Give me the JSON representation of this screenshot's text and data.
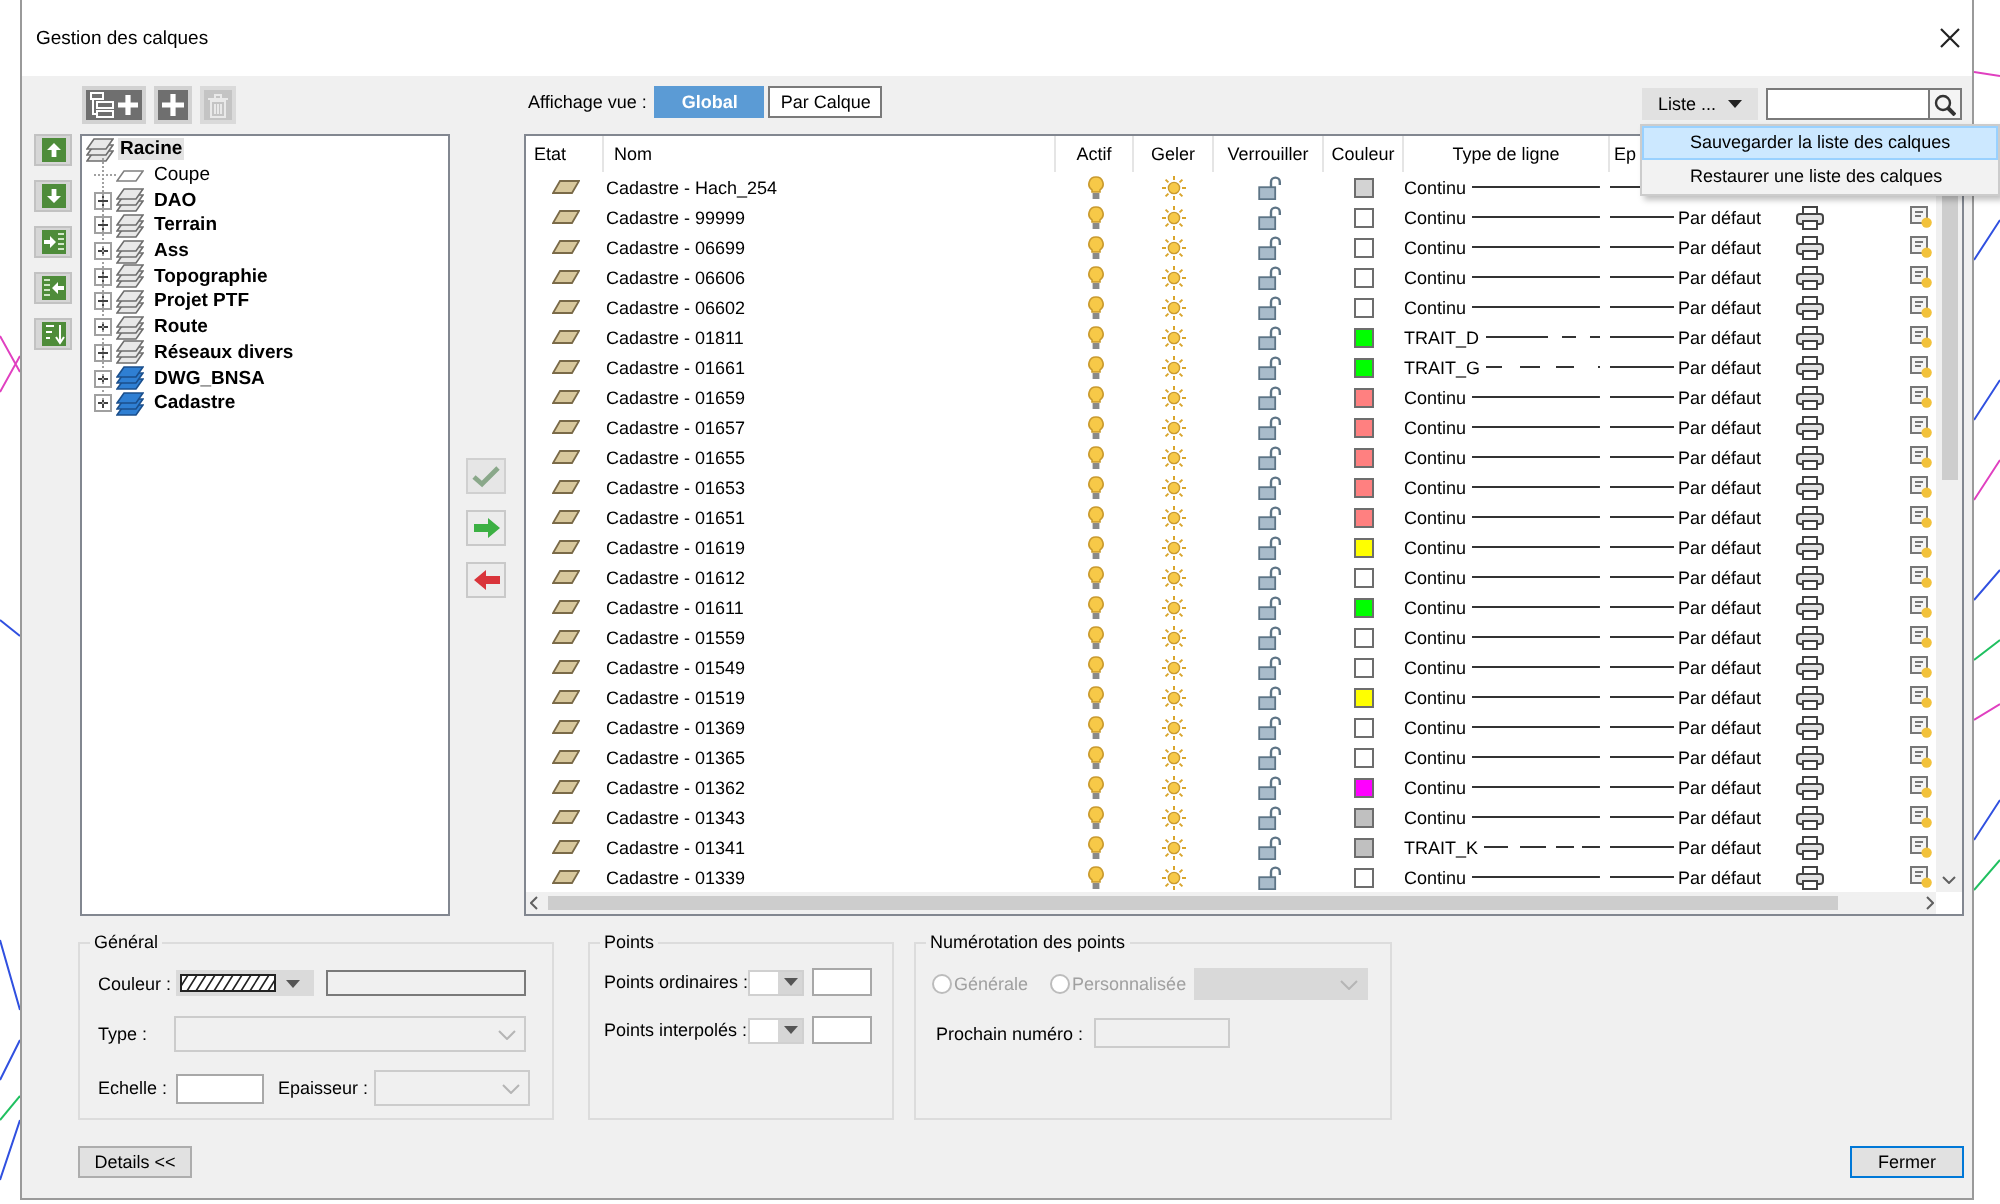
{
  "window": {
    "title": "Gestion des calques"
  },
  "toolbar": [
    {
      "kind": "add_group",
      "disabled": false
    },
    {
      "kind": "add_layer",
      "disabled": false
    },
    {
      "kind": "delete",
      "disabled": true
    }
  ],
  "side_buttons": [
    {
      "kind": "up"
    },
    {
      "kind": "down"
    },
    {
      "kind": "import"
    },
    {
      "kind": "export"
    },
    {
      "kind": "sort"
    }
  ],
  "tree": {
    "items": [
      {
        "label": "Racine",
        "kind": "root",
        "selected": true,
        "children": [
          {
            "label": "Coupe",
            "kind": "layer",
            "selected": false
          },
          {
            "label": "DAO",
            "kind": "group",
            "expanded": false,
            "selected": false
          },
          {
            "label": "Terrain",
            "kind": "group",
            "expanded": false,
            "selected": false
          },
          {
            "label": "Ass",
            "kind": "group",
            "expanded": false,
            "selected": false
          },
          {
            "label": "Topographie",
            "kind": "group",
            "expanded": false,
            "selected": false
          },
          {
            "label": "Projet PTF",
            "kind": "group",
            "expanded": false,
            "selected": false
          },
          {
            "label": "Route",
            "kind": "group",
            "expanded": false,
            "selected": false
          },
          {
            "label": "Réseaux divers",
            "kind": "group",
            "expanded": false,
            "selected": false
          },
          {
            "label": "DWG_BNSA",
            "kind": "xref",
            "expanded": false,
            "selected": false
          },
          {
            "label": "Cadastre",
            "kind": "xref",
            "expanded": false,
            "selected": false
          }
        ]
      }
    ]
  },
  "transfer_buttons": [
    {
      "kind": "apply",
      "disabled": true
    },
    {
      "kind": "add",
      "disabled": false
    },
    {
      "kind": "remove",
      "disabled": false
    }
  ],
  "view": {
    "label": "Affichage vue :",
    "options": [
      {
        "label": "Global",
        "selected": true
      },
      {
        "label": "Par Calque",
        "selected": false
      }
    ]
  },
  "list_button": {
    "label": "Liste ..."
  },
  "list_menu": {
    "items": [
      {
        "label": "Sauvegarder la liste des calques",
        "selected": true
      },
      {
        "label": "Restaurer une liste des calques",
        "selected": false
      }
    ]
  },
  "table": {
    "columns": [
      "Etat",
      "Nom",
      "Actif",
      "Geler",
      "Verrouiller",
      "Couleur",
      "Type de ligne",
      "Ep"
    ],
    "rows": [
      {
        "name": "Cadastre - Hach_254",
        "active": true,
        "frozen": false,
        "locked": false,
        "color": "#d3d3d3",
        "linetype": {
          "name": "Continu",
          "kind": "solid"
        }
      },
      {
        "name": "Cadastre - 99999",
        "active": true,
        "frozen": false,
        "locked": false,
        "color": "#ffffff",
        "linetype": {
          "name": "Continu",
          "kind": "solid"
        },
        "weight": "Par défaut",
        "plot": true
      },
      {
        "name": "Cadastre - 06699",
        "active": true,
        "frozen": false,
        "locked": false,
        "color": "#ffffff",
        "linetype": {
          "name": "Continu",
          "kind": "solid"
        },
        "weight": "Par défaut",
        "plot": true
      },
      {
        "name": "Cadastre - 06606",
        "active": true,
        "frozen": false,
        "locked": false,
        "color": "#ffffff",
        "linetype": {
          "name": "Continu",
          "kind": "solid"
        },
        "weight": "Par défaut",
        "plot": true
      },
      {
        "name": "Cadastre - 06602",
        "active": true,
        "frozen": false,
        "locked": false,
        "color": "#ffffff",
        "linetype": {
          "name": "Continu",
          "kind": "solid"
        },
        "weight": "Par défaut",
        "plot": true
      },
      {
        "name": "Cadastre - 01811",
        "active": true,
        "frozen": false,
        "locked": false,
        "color": "#00ff00",
        "linetype": {
          "name": "TRAIT_D",
          "kind": "longshort"
        },
        "weight": "Par défaut",
        "plot": true
      },
      {
        "name": "Cadastre - 01661",
        "active": true,
        "frozen": false,
        "locked": false,
        "color": "#00ff00",
        "linetype": {
          "name": "TRAIT_G",
          "kind": "dashdot"
        },
        "weight": "Par défaut",
        "plot": true
      },
      {
        "name": "Cadastre - 01659",
        "active": true,
        "frozen": false,
        "locked": false,
        "color": "#ff8080",
        "linetype": {
          "name": "Continu",
          "kind": "solid"
        },
        "weight": "Par défaut",
        "plot": true
      },
      {
        "name": "Cadastre - 01657",
        "active": true,
        "frozen": false,
        "locked": false,
        "color": "#ff8080",
        "linetype": {
          "name": "Continu",
          "kind": "solid"
        },
        "weight": "Par défaut",
        "plot": true
      },
      {
        "name": "Cadastre - 01655",
        "active": true,
        "frozen": false,
        "locked": false,
        "color": "#ff8080",
        "linetype": {
          "name": "Continu",
          "kind": "solid"
        },
        "weight": "Par défaut",
        "plot": true
      },
      {
        "name": "Cadastre - 01653",
        "active": true,
        "frozen": false,
        "locked": false,
        "color": "#ff8080",
        "linetype": {
          "name": "Continu",
          "kind": "solid"
        },
        "weight": "Par défaut",
        "plot": true
      },
      {
        "name": "Cadastre - 01651",
        "active": true,
        "frozen": false,
        "locked": false,
        "color": "#ff8080",
        "linetype": {
          "name": "Continu",
          "kind": "solid"
        },
        "weight": "Par défaut",
        "plot": true
      },
      {
        "name": "Cadastre - 01619",
        "active": true,
        "frozen": false,
        "locked": false,
        "color": "#ffff00",
        "linetype": {
          "name": "Continu",
          "kind": "solid"
        },
        "weight": "Par défaut",
        "plot": true
      },
      {
        "name": "Cadastre - 01612",
        "active": true,
        "frozen": false,
        "locked": false,
        "color": "#ffffff",
        "linetype": {
          "name": "Continu",
          "kind": "solid"
        },
        "weight": "Par défaut",
        "plot": true
      },
      {
        "name": "Cadastre - 01611",
        "active": true,
        "frozen": false,
        "locked": false,
        "color": "#00ff00",
        "linetype": {
          "name": "Continu",
          "kind": "solid"
        },
        "weight": "Par défaut",
        "plot": true
      },
      {
        "name": "Cadastre - 01559",
        "active": true,
        "frozen": false,
        "locked": false,
        "color": "#ffffff",
        "linetype": {
          "name": "Continu",
          "kind": "solid"
        },
        "weight": "Par défaut",
        "plot": true
      },
      {
        "name": "Cadastre - 01549",
        "active": true,
        "frozen": false,
        "locked": false,
        "color": "#ffffff",
        "linetype": {
          "name": "Continu",
          "kind": "solid"
        },
        "weight": "Par défaut",
        "plot": true
      },
      {
        "name": "Cadastre - 01519",
        "active": true,
        "frozen": false,
        "locked": false,
        "color": "#ffff00",
        "linetype": {
          "name": "Continu",
          "kind": "solid"
        },
        "weight": "Par défaut",
        "plot": true
      },
      {
        "name": "Cadastre - 01369",
        "active": true,
        "frozen": false,
        "locked": false,
        "color": "#ffffff",
        "linetype": {
          "name": "Continu",
          "kind": "solid"
        },
        "weight": "Par défaut",
        "plot": true
      },
      {
        "name": "Cadastre - 01365",
        "active": true,
        "frozen": false,
        "locked": false,
        "color": "#ffffff",
        "linetype": {
          "name": "Continu",
          "kind": "solid"
        },
        "weight": "Par défaut",
        "plot": true
      },
      {
        "name": "Cadastre - 01362",
        "active": true,
        "frozen": false,
        "locked": false,
        "color": "#ff00ff",
        "linetype": {
          "name": "Continu",
          "kind": "solid"
        },
        "weight": "Par défaut",
        "plot": true
      },
      {
        "name": "Cadastre - 01343",
        "active": true,
        "frozen": false,
        "locked": false,
        "color": "#c0c0c0",
        "linetype": {
          "name": "Continu",
          "kind": "solid"
        },
        "weight": "Par défaut",
        "plot": true
      },
      {
        "name": "Cadastre - 01341",
        "active": true,
        "frozen": false,
        "locked": false,
        "color": "#c0c0c0",
        "linetype": {
          "name": "TRAIT_K",
          "kind": "dashed"
        },
        "weight": "Par défaut",
        "plot": true
      },
      {
        "name": "Cadastre - 01339",
        "active": true,
        "frozen": false,
        "locked": false,
        "color": "#ffffff",
        "linetype": {
          "name": "Continu",
          "kind": "solid"
        },
        "weight": "Par défaut",
        "plot": true
      }
    ]
  },
  "details": {
    "general": {
      "title": "Général",
      "color_label": "Couleur :",
      "type_label": "Type :",
      "type_disabled": true,
      "scale_label": "Echelle :",
      "weight_label": "Epaisseur :",
      "weight_disabled": true
    },
    "points": {
      "title": "Points",
      "rows": [
        {
          "label": "Points ordinaires :"
        },
        {
          "label": "Points interpolés :"
        }
      ]
    },
    "numbering": {
      "title": "Numérotation des points",
      "options": [
        {
          "label": "Générale",
          "selected": false,
          "disabled": true
        },
        {
          "label": "Personnalisée",
          "selected": false,
          "disabled": true
        }
      ],
      "mode_disabled": true,
      "next_label": "Prochain numéro :",
      "next_disabled": true
    }
  },
  "buttons": [
    {
      "label": "Details <<",
      "default": false
    },
    {
      "label": "Fermer",
      "default": true
    }
  ]
}
